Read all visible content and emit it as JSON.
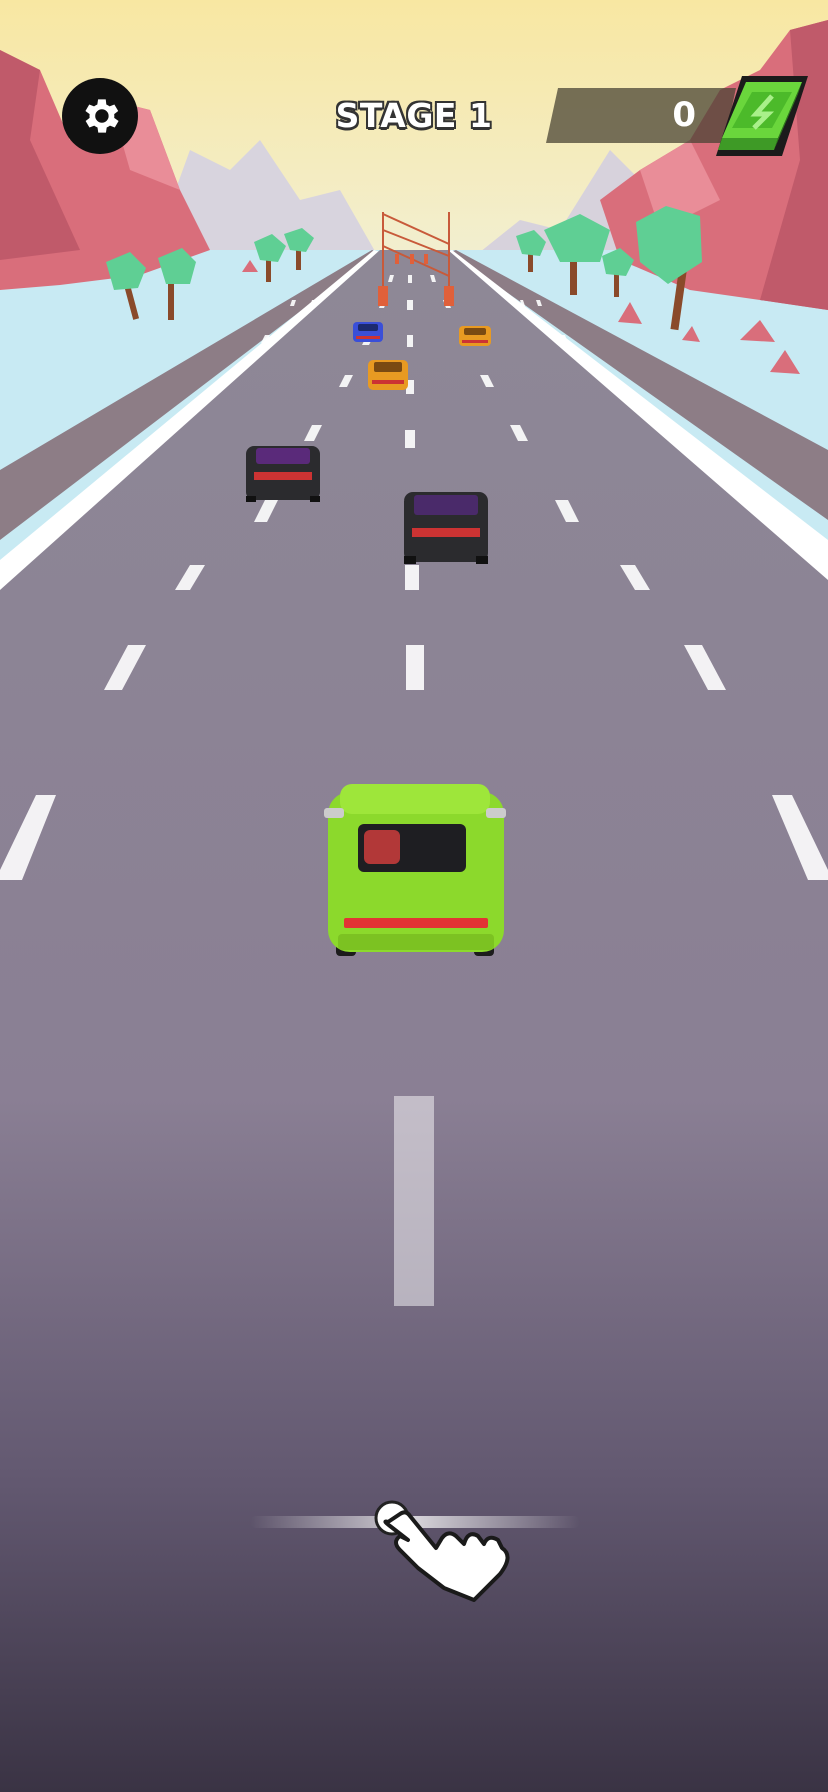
{
  "hud": {
    "stage_label": "STAGE 1",
    "cash_count": "0",
    "settings_icon": "gear-icon",
    "cash_icon": "green-cash-stack-icon"
  },
  "tutorial": {
    "hint_icon": "swipe-hand-icon"
  },
  "colors": {
    "sky_top": "#f7e9a8",
    "sky_bottom": "#eef3dc",
    "snow": "#c9ecf4",
    "road_far": "#8d8793",
    "road_near": "#3f3848",
    "lane_marking": "#ffffff",
    "player_car": "#8fdc2c",
    "rocks": "#d96f7c",
    "trees": "#5fcf94",
    "cash": "#4cba2a"
  }
}
